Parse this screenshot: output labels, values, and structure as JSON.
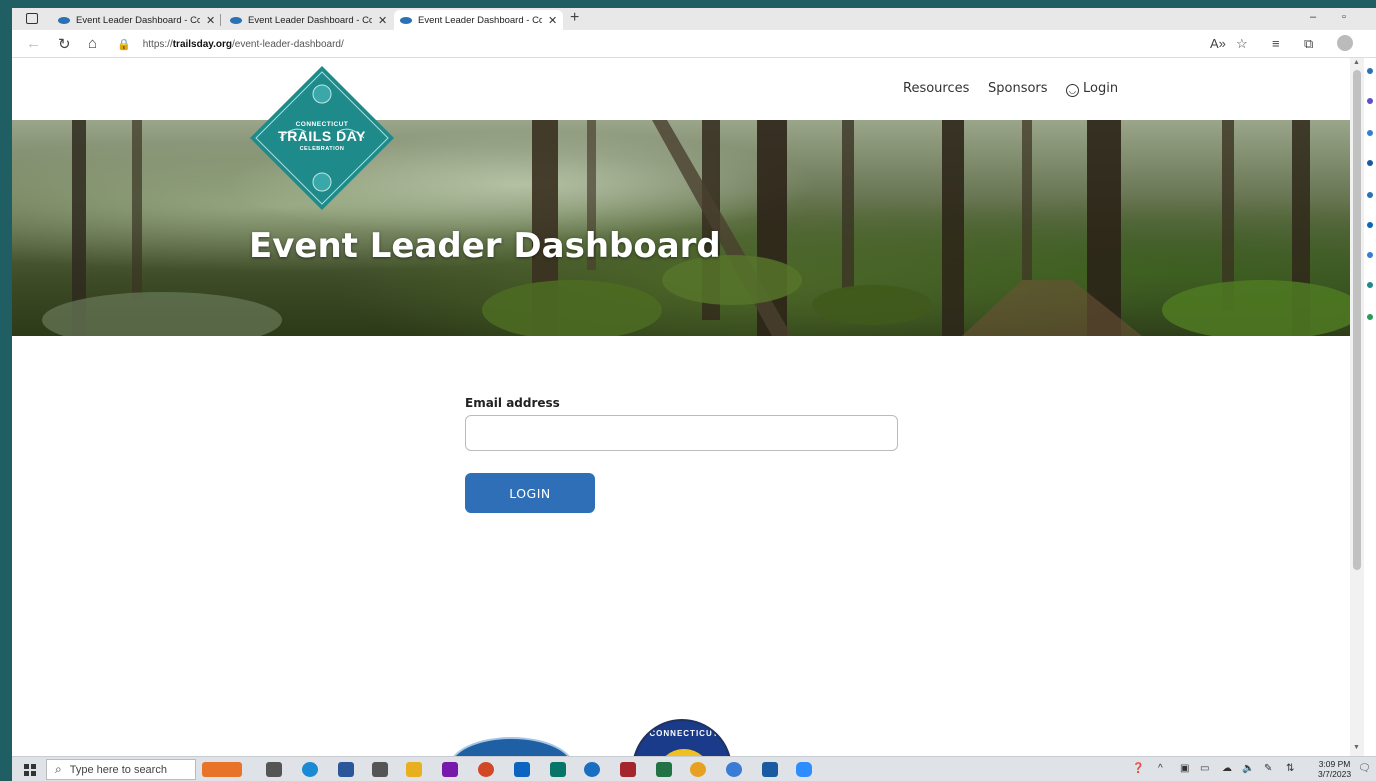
{
  "browser": {
    "tabs": [
      {
        "title": "Event Leader Dashboard - Connecticut Trails Day",
        "active": false
      },
      {
        "title": "Event Leader Dashboard - Connecticut Trails Day",
        "active": false
      },
      {
        "title": "Event Leader Dashboard - Connecticut Trails Day",
        "active": true
      }
    ],
    "url_scheme": "https://",
    "url_domain": "trailsday.org",
    "url_path": "/event-leader-dashboard/"
  },
  "site": {
    "logo": {
      "line1": "CONNECTICUT",
      "line2": "TRAILS DAY",
      "line3": "CELEBRATION"
    },
    "nav": {
      "resources": "Resources",
      "sponsors": "Sponsors",
      "login": "Login"
    },
    "hero_title": "Event Leader Dashboard",
    "form": {
      "email_label": "Email address",
      "email_value": "",
      "email_placeholder": "",
      "login_button": "LOGIN"
    },
    "sponsor_badges": {
      "badge2_text": "CONNECTICUT"
    }
  },
  "taskbar": {
    "search_placeholder": "Type here to search",
    "time": "3:09 PM",
    "date": "3/7/2023"
  },
  "colors": {
    "accent": "#2e6fb8",
    "logo_teal": "#1f8a8a",
    "desktop": "#1f5e63"
  }
}
